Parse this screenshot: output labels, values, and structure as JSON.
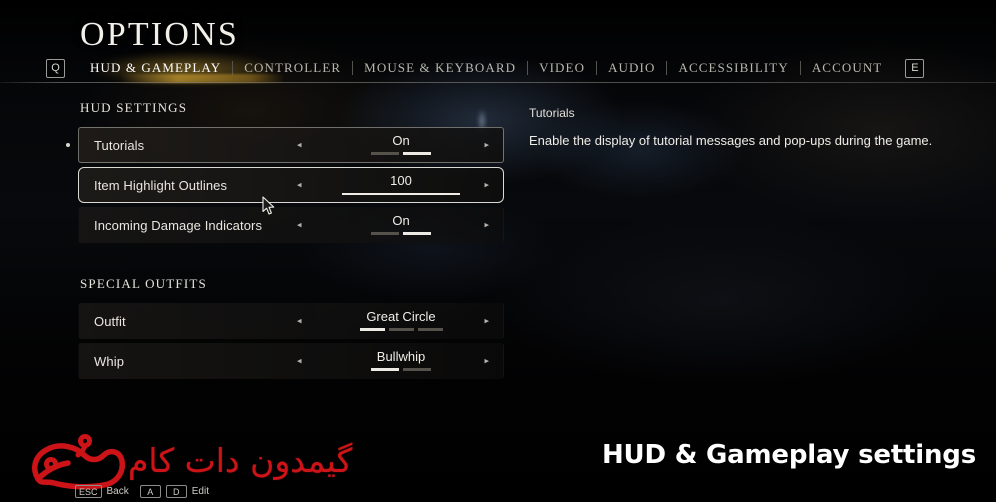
{
  "header": {
    "title": "OPTIONS",
    "left_key": "Q",
    "right_key": "E",
    "tabs": [
      {
        "label": "HUD & GAMEPLAY",
        "active": true
      },
      {
        "label": "CONTROLLER",
        "active": false
      },
      {
        "label": "MOUSE & KEYBOARD",
        "active": false
      },
      {
        "label": "VIDEO",
        "active": false
      },
      {
        "label": "AUDIO",
        "active": false
      },
      {
        "label": "ACCESSIBILITY",
        "active": false
      },
      {
        "label": "ACCOUNT",
        "active": false
      }
    ]
  },
  "sections": [
    {
      "label": "HUD SETTINGS",
      "rows": [
        {
          "label": "Tutorials",
          "value": "On",
          "control": "segments",
          "segments": 2,
          "active_segment": 2,
          "left_arrow": "◂",
          "right_arrow": "▸",
          "selected": true,
          "hovered": false
        },
        {
          "label": "Item Highlight Outlines",
          "value": "100",
          "control": "slider",
          "slider_percent": 100,
          "left_arrow": "◂",
          "right_arrow": "▸",
          "selected": false,
          "hovered": true
        },
        {
          "label": "Incoming Damage Indicators",
          "value": "On",
          "control": "segments",
          "segments": 2,
          "active_segment": 2,
          "left_arrow": "◂",
          "right_arrow": "▸",
          "selected": false,
          "hovered": false
        }
      ]
    },
    {
      "label": "SPECIAL OUTFITS",
      "rows": [
        {
          "label": "Outfit",
          "value": "Great Circle",
          "control": "segments",
          "segments": 3,
          "active_segment": 1,
          "left_arrow": "◂",
          "right_arrow": "▸",
          "selected": false,
          "hovered": false
        },
        {
          "label": "Whip",
          "value": "Bullwhip",
          "control": "segments",
          "segments": 2,
          "active_segment": 1,
          "left_arrow": "◂",
          "right_arrow": "▸",
          "selected": false,
          "hovered": false
        }
      ]
    }
  ],
  "description": {
    "title": "Tutorials",
    "body": "Enable the display of tutorial messages and pop-ups during the game."
  },
  "prompts": [
    {
      "key": "ESC",
      "label": "Back"
    },
    {
      "key": "A",
      "key2": "D",
      "label": "Edit"
    }
  ],
  "watermark": {
    "text": "گیمدون دات کام",
    "color": "#cc1418"
  },
  "caption": "HUD & Gameplay settings"
}
